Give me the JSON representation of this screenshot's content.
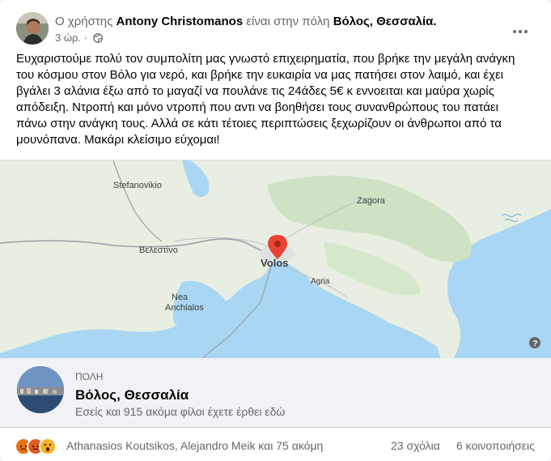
{
  "post": {
    "author": "Antony Christomanos",
    "header_prefix": "Ο χρήστης",
    "header_middle": "είναι στην πόλη",
    "location": "Βόλος, Θεσσαλία.",
    "time": "3 ώρ.",
    "body": [
      "Ευχαριστούμε πολύ τον συμπολίτη μας γνωστό επιχειρηματία, που βρήκε την μεγάλη ανάγκη",
      "του κόσμου στον Βόλο για νερό, και βρήκε την ευκαιρία να μας πατήσει στον λαιμό, και έχει",
      "βγάλει 3 αλάνια έξω από το μαγαζί να πουλάνε τις 24άδες 5€ κ εννοειται και μαύρα χωρίς",
      "απόδειξη. Ντροπή και μόνο ντροπή που αντι να βοηθήσει τους συνανθρώπους του πατάει",
      "πάνω στην ανάγκη τους. Αλλά σε κάτι τέτοιες περιπτώσεις ξεχωρίζουν οι άνθρωποι από τα",
      "μουνόπανα. Μακάρι κλείσιμο εύχομαι!"
    ]
  },
  "map": {
    "labels": {
      "stefanoviki": "Stefanovikio",
      "zagora": "Zagora",
      "velestino": "Βελεστίνο",
      "volos": "Volos",
      "agria": "Agria",
      "nea": "Nea",
      "anchialos": "Anchialos"
    }
  },
  "place": {
    "type": "ΠΟΛΗ",
    "name": "Βόλος, Θεσσαλία",
    "subtitle": "Εσείς και 915 ακόμα φίλοι έχετε έρθει εδώ"
  },
  "footer": {
    "reactors": "Athanasios Koutsikos, Alejandro Meik και 75 ακόμη",
    "comments": "23 σχόλια",
    "shares": "6 κοινοποιήσεις"
  },
  "colors": {
    "sea": "#a9d6f2",
    "land": "#e8efe2",
    "pin": "#ea4335",
    "muted": "#65676b"
  },
  "icons": [
    "globe-icon",
    "more-icon",
    "pin-icon",
    "expand-icon",
    "angry-icon",
    "wow-icon"
  ]
}
